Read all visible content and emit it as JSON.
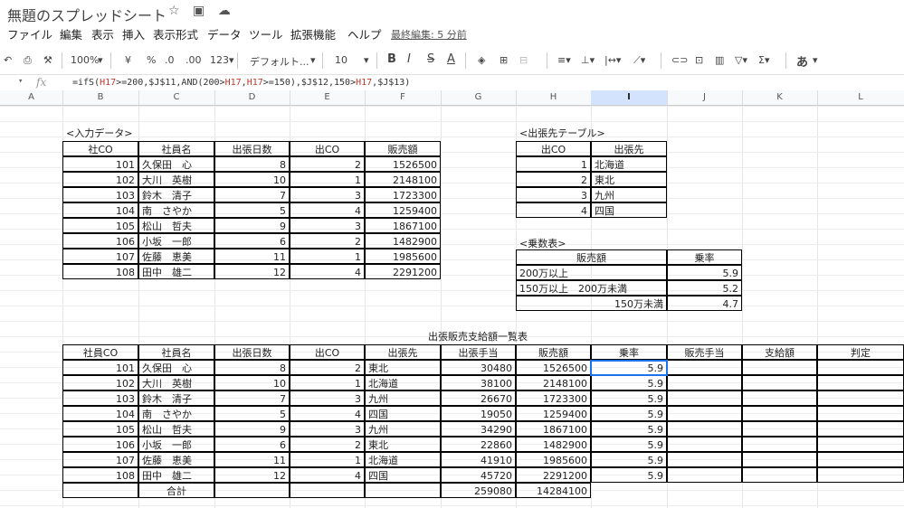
{
  "app": {
    "title": "無題のスプレッドシート",
    "icons": [
      "star-icon",
      "folder-move-icon",
      "cloud-status-icon"
    ]
  },
  "menu": {
    "items": [
      "ファイル",
      "編集",
      "表示",
      "挿入",
      "表示形式",
      "データ",
      "ツール",
      "拡張機能",
      "ヘルプ"
    ],
    "last_edit": "最終編集: 5 分前"
  },
  "toolbar": {
    "zoom": "100%",
    "currency": "¥",
    "percent": "%",
    "dec_minus": ".0",
    "dec_plus": ".00",
    "format123": "123▾",
    "font": "デフォルト...",
    "font_size": "10",
    "bold": "B",
    "italic": "I",
    "strike": "S",
    "textcolor": "A",
    "ime": "あ"
  },
  "formula_bar": {
    "fx": "fx",
    "prefix": "=ifS(",
    "r1": "H17",
    "p1": ">=200,$J$11,AND(200>",
    "r2": "H17",
    "p2": ",",
    "r3": "H17",
    "p3": ">=150),$J$12,150>",
    "r4": "H17",
    "p4": ",$J$13)"
  },
  "columns": [
    "A",
    "B",
    "C",
    "D",
    "E",
    "F",
    "G",
    "H",
    "I",
    "J",
    "K",
    "L"
  ],
  "input_table": {
    "title": "<入力データ>",
    "headers": [
      "社CO",
      "社員名",
      "出張日数",
      "出CO",
      "販売額"
    ],
    "rows": [
      [
        "101",
        "久保田　心",
        "8",
        "2",
        "1526500"
      ],
      [
        "102",
        "大川　英樹",
        "10",
        "1",
        "2148100"
      ],
      [
        "103",
        "鈴木　清子",
        "7",
        "3",
        "1723300"
      ],
      [
        "104",
        "南　さやか",
        "5",
        "4",
        "1259400"
      ],
      [
        "105",
        "松山　哲夫",
        "9",
        "3",
        "1867100"
      ],
      [
        "106",
        "小坂　一郎",
        "6",
        "2",
        "1482900"
      ],
      [
        "107",
        "佐藤　恵美",
        "11",
        "1",
        "1985600"
      ],
      [
        "108",
        "田中　雄二",
        "12",
        "4",
        "2291200"
      ]
    ]
  },
  "dest_table": {
    "title": "<出張先テーブル>",
    "headers": [
      "出CO",
      "出張先"
    ],
    "rows": [
      [
        "1",
        "北海道"
      ],
      [
        "2",
        "東北"
      ],
      [
        "3",
        "九州"
      ],
      [
        "4",
        "四国"
      ]
    ]
  },
  "rate_table": {
    "title": "<乗数表>",
    "headers": [
      "販売額",
      "乗率"
    ],
    "rows": [
      [
        "200万以上",
        "5.9"
      ],
      [
        "150万以上　200万未満",
        "5.2"
      ],
      [
        "150万未満",
        "4.7"
      ]
    ]
  },
  "summary": {
    "title": "出張販売支給額一覧表",
    "headers": [
      "社員CO",
      "社員名",
      "出張日数",
      "出CO",
      "出張先",
      "出張手当",
      "販売額",
      "乗率",
      "販売手当",
      "支給額",
      "判定"
    ],
    "rows": [
      [
        "101",
        "久保田　心",
        "8",
        "2",
        "東北",
        "30480",
        "1526500",
        "5.9",
        "",
        "",
        ""
      ],
      [
        "102",
        "大川　英樹",
        "10",
        "1",
        "北海道",
        "38100",
        "2148100",
        "5.9",
        "",
        "",
        ""
      ],
      [
        "103",
        "鈴木　清子",
        "7",
        "3",
        "九州",
        "26670",
        "1723300",
        "5.9",
        "",
        "",
        ""
      ],
      [
        "104",
        "南　さやか",
        "5",
        "4",
        "四国",
        "19050",
        "1259400",
        "5.9",
        "",
        "",
        ""
      ],
      [
        "105",
        "松山　哲夫",
        "9",
        "3",
        "九州",
        "34290",
        "1867100",
        "5.9",
        "",
        "",
        ""
      ],
      [
        "106",
        "小坂　一郎",
        "6",
        "2",
        "東北",
        "22860",
        "1482900",
        "5.9",
        "",
        "",
        ""
      ],
      [
        "107",
        "佐藤　恵美",
        "11",
        "1",
        "北海道",
        "41910",
        "1985600",
        "5.9",
        "",
        "",
        ""
      ],
      [
        "108",
        "田中　雄二",
        "12",
        "4",
        "四国",
        "45720",
        "2291200",
        "5.9",
        "",
        "",
        ""
      ]
    ],
    "total_label": "合計",
    "total_allowance": "259080",
    "total_sales": "14284100"
  }
}
